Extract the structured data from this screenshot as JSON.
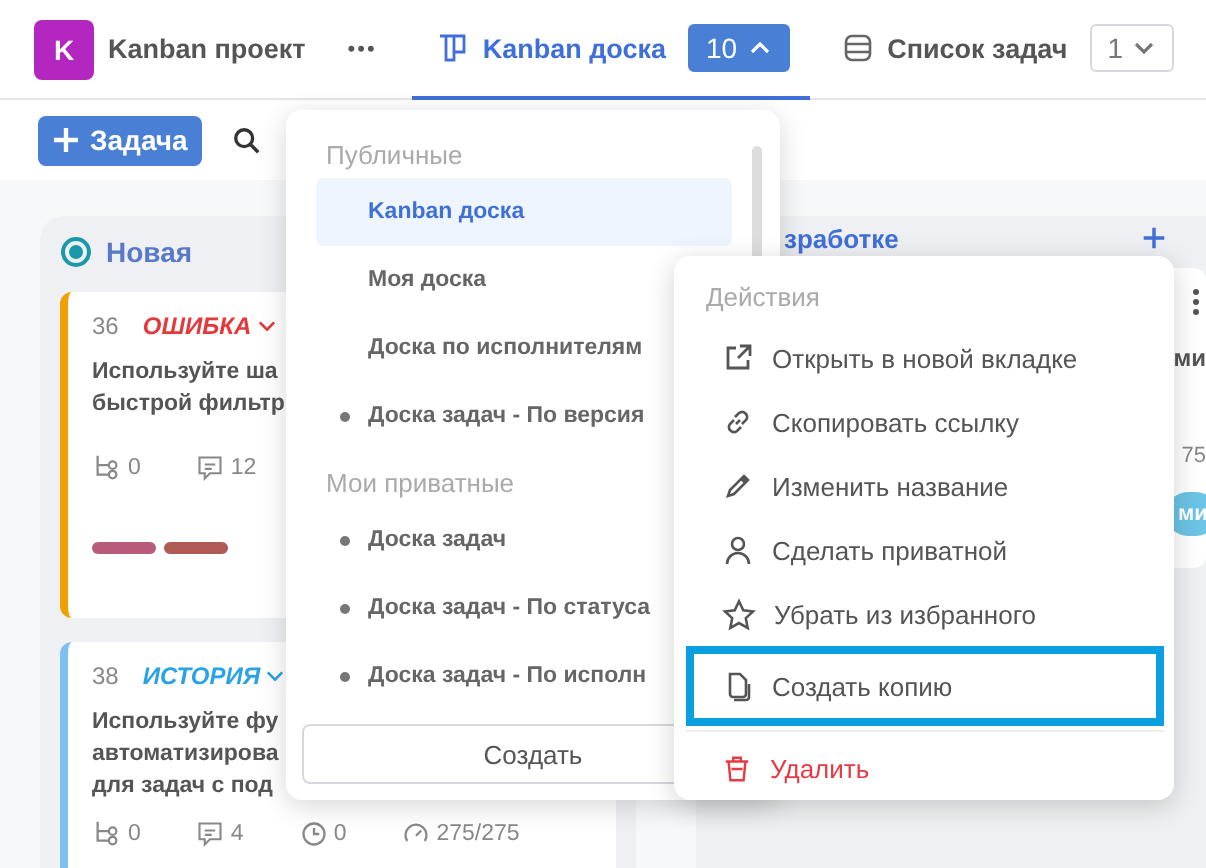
{
  "project": {
    "avatar": "K",
    "name": "Kanban проект",
    "more": "•••"
  },
  "tabs": [
    {
      "label": "Kanban доска",
      "kind": "board",
      "badge": "10",
      "selected": true,
      "expanded": true
    },
    {
      "label": "Список задач",
      "kind": "list",
      "badge": "1",
      "selected": false,
      "expanded": false
    }
  ],
  "toolbar": {
    "add_label": "Задача"
  },
  "columns": [
    {
      "title": "Новая",
      "cards": [
        {
          "number": "36",
          "type": "ОШИБКА",
          "kind": "bug",
          "title_lines": [
            "Используйте ша",
            "быстрой фильтр"
          ],
          "stats": [
            {
              "kind": "subtasks",
              "value": "0"
            },
            {
              "kind": "comments",
              "value": "12"
            }
          ],
          "tags": [
            {
              "color": "#b85a7a"
            },
            {
              "color": "#b05a55"
            }
          ]
        },
        {
          "number": "38",
          "type": "ИСТОРИЯ",
          "kind": "story",
          "title_lines": [
            "Используйте фу",
            "автоматизирова",
            "для задач с под"
          ],
          "stats": [
            {
              "kind": "subtasks",
              "value": "0"
            },
            {
              "kind": "comments",
              "value": "4"
            },
            {
              "kind": "time",
              "value": "0"
            },
            {
              "kind": "estimate",
              "value": "275/275"
            }
          ]
        }
      ]
    },
    {
      "title": "зработке",
      "card": {
        "title_fragment": "ми",
        "stat_fragment": "75",
        "avatar": "ми"
      }
    }
  ],
  "board_menu": {
    "sections": [
      {
        "title": "Публичные",
        "items": [
          {
            "label": "Kanban доска",
            "selected": true,
            "dot": false
          },
          {
            "label": "Моя доска",
            "selected": false,
            "dot": false
          },
          {
            "label": "Доска по исполнителям",
            "selected": false,
            "dot": false
          },
          {
            "label": "Доска задач - По версия",
            "selected": false,
            "dot": true
          }
        ]
      },
      {
        "title": "Мои приватные",
        "items": [
          {
            "label": "Доска задач",
            "selected": false,
            "dot": true
          },
          {
            "label": "Доска задач - По статуса",
            "selected": false,
            "dot": true
          },
          {
            "label": "Доска задач - По исполн",
            "selected": false,
            "dot": true
          }
        ]
      }
    ],
    "create_label": "Создать"
  },
  "actions_menu": {
    "title": "Действия",
    "items": [
      {
        "label": "Открыть в новой вкладке",
        "kind": "external",
        "highlighted": false,
        "danger": false
      },
      {
        "label": "Скопировать ссылку",
        "kind": "link",
        "highlighted": false,
        "danger": false
      },
      {
        "label": "Изменить название",
        "kind": "rename",
        "highlighted": false,
        "danger": false
      },
      {
        "label": "Сделать приватной",
        "kind": "private",
        "highlighted": false,
        "danger": false
      },
      {
        "label": "Убрать из избранного",
        "kind": "favorite",
        "highlighted": false,
        "danger": false
      },
      {
        "label": "Создать копию",
        "kind": "copy",
        "highlighted": true,
        "danger": false
      },
      {
        "label": "Удалить",
        "kind": "delete",
        "highlighted": false,
        "danger": true
      }
    ]
  }
}
